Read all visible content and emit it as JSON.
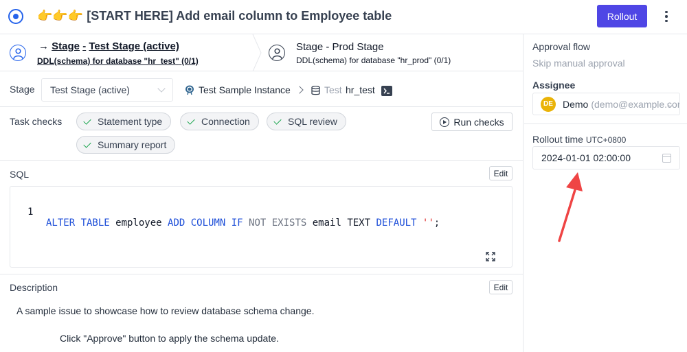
{
  "header": {
    "title": "👉👉👉 [START HERE] Add email column to Employee table",
    "rollout_label": "Rollout"
  },
  "stages": {
    "active": {
      "title_prefix": "Stage",
      "title_sep": "-",
      "title_name": "Test Stage (active)",
      "subtitle": "DDL(schema) for database \"hr_test\"",
      "count": "(0/1)"
    },
    "next": {
      "title": "Stage - Prod Stage",
      "subtitle": "DDL(schema) for database \"hr_prod\"",
      "count": "(0/1)"
    }
  },
  "stage_row": {
    "label": "Stage",
    "selected": "Test Stage (active)",
    "instance": "Test Sample Instance",
    "environment": "Test",
    "database": "hr_test"
  },
  "task_checks": {
    "label": "Task checks",
    "checks": [
      "Statement type",
      "Connection",
      "SQL review",
      "Summary report"
    ],
    "run_label": "Run checks"
  },
  "sql": {
    "label": "SQL",
    "edit_label": "Edit",
    "line_number": "1",
    "tokens": {
      "t1": "ALTER TABLE",
      "t2": " employee ",
      "t3": "ADD COLUMN",
      "t4": " IF",
      "t5": " NOT EXISTS",
      "t6": " email TEXT ",
      "t7": "DEFAULT",
      "t8": " ''",
      "t9": ";"
    }
  },
  "description": {
    "label": "Description",
    "edit_label": "Edit",
    "line1": "A sample issue to showcase how to review database schema change.",
    "line2": "Click \"Approve\" button to apply the schema update."
  },
  "sidebar": {
    "approval_label": "Approval flow",
    "approval_value": "Skip manual approval",
    "assignee_label": "Assignee",
    "assignee_initials": "DE",
    "assignee_name": "Demo",
    "assignee_email": "(demo@example.com)",
    "rollout_time_label": "Rollout time",
    "timezone": "UTC+0800",
    "rollout_time_value": "2024-01-01 02:00:00"
  },
  "colors": {
    "accent": "#4f46e5",
    "link_blue": "#2563eb",
    "success": "#16a34a",
    "annotation_arrow": "#ef4444",
    "avatar": "#eab308"
  }
}
